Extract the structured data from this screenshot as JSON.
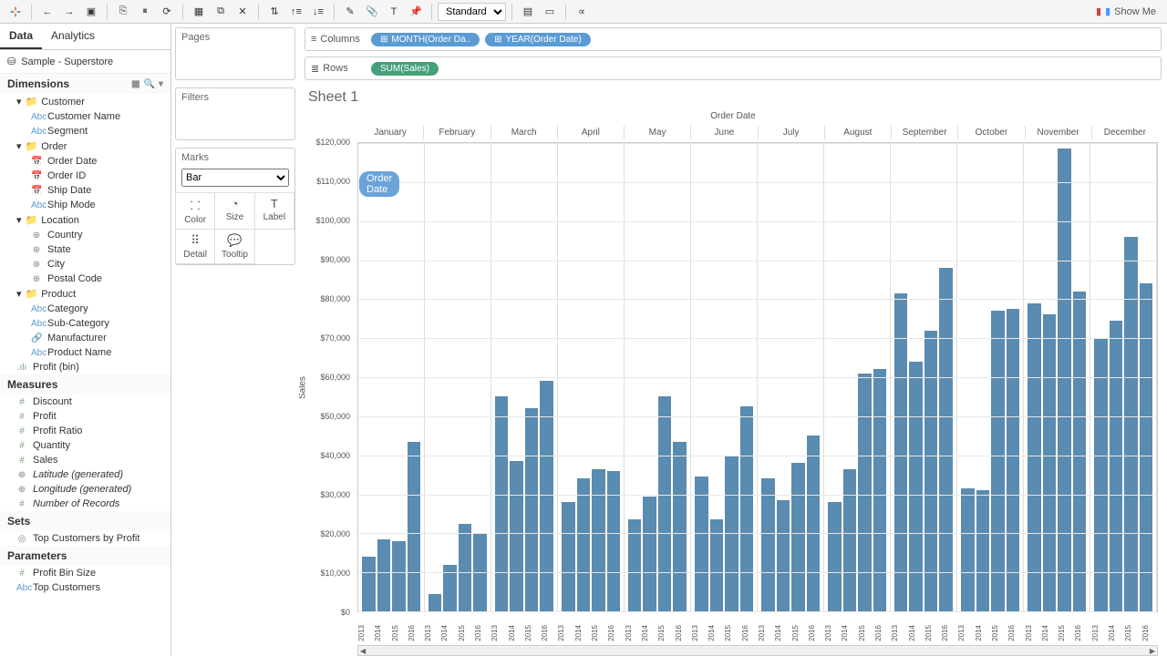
{
  "toolbar": {
    "fit_mode": "Standard",
    "showme_label": "Show Me"
  },
  "data_panel": {
    "tabs": [
      "Data",
      "Analytics"
    ],
    "active_tab": 0,
    "source": "Sample - Superstore",
    "dimensions_label": "Dimensions",
    "measures_label": "Measures",
    "sets_label": "Sets",
    "parameters_label": "Parameters",
    "folders": [
      {
        "name": "Customer",
        "items": [
          {
            "icon": "abc",
            "label": "Customer Name"
          },
          {
            "icon": "abc",
            "label": "Segment"
          }
        ]
      },
      {
        "name": "Order",
        "items": [
          {
            "icon": "date",
            "label": "Order Date"
          },
          {
            "icon": "date",
            "label": "Order ID"
          },
          {
            "icon": "date",
            "label": "Ship Date"
          },
          {
            "icon": "abc",
            "label": "Ship Mode"
          }
        ]
      },
      {
        "name": "Location",
        "items": [
          {
            "icon": "geo",
            "label": "Country"
          },
          {
            "icon": "geo",
            "label": "State"
          },
          {
            "icon": "geo",
            "label": "City"
          },
          {
            "icon": "geo",
            "label": "Postal Code"
          }
        ]
      },
      {
        "name": "Product",
        "items": [
          {
            "icon": "abc",
            "label": "Category"
          },
          {
            "icon": "abc",
            "label": "Sub-Category"
          },
          {
            "icon": "link",
            "label": "Manufacturer"
          },
          {
            "icon": "abc",
            "label": "Product Name"
          }
        ]
      }
    ],
    "dim_tail": {
      "icon": "num",
      "label": "Profit (bin)"
    },
    "measures": [
      {
        "icon": "num",
        "label": "Discount"
      },
      {
        "icon": "num",
        "label": "Profit"
      },
      {
        "icon": "num",
        "label": "Profit Ratio"
      },
      {
        "icon": "num",
        "label": "Quantity"
      },
      {
        "icon": "num",
        "label": "Sales"
      },
      {
        "icon": "geo",
        "label": "Latitude (generated)",
        "italic": true
      },
      {
        "icon": "geo",
        "label": "Longitude (generated)",
        "italic": true
      },
      {
        "icon": "num",
        "label": "Number of Records",
        "italic": true
      }
    ],
    "sets": [
      {
        "icon": "set",
        "label": "Top Customers by Profit"
      }
    ],
    "parameters": [
      {
        "icon": "num",
        "label": "Profit Bin Size"
      },
      {
        "icon": "abc",
        "label": "Top Customers"
      }
    ]
  },
  "shelves": {
    "pages_label": "Pages",
    "filters_label": "Filters",
    "marks_label": "Marks",
    "mark_type": "Bar",
    "drag_ghost": "Order Date",
    "cells": [
      "Color",
      "Size",
      "Label",
      "Detail",
      "Tooltip"
    ]
  },
  "colrow": {
    "columns_label": "Columns",
    "rows_label": "Rows",
    "column_pills": [
      "MONTH(Order Da..",
      "YEAR(Order Date)"
    ],
    "row_pills": [
      "SUM(Sales)"
    ]
  },
  "sheet_title": "Sheet 1",
  "chart_data": {
    "type": "bar",
    "title": "Order Date",
    "ylabel": "Sales",
    "ylim": [
      0,
      120000
    ],
    "y_ticks": [
      "$0",
      "$10,000",
      "$20,000",
      "$30,000",
      "$40,000",
      "$50,000",
      "$60,000",
      "$70,000",
      "$80,000",
      "$90,000",
      "$100,000",
      "$110,000",
      "$120,000"
    ],
    "months": [
      "January",
      "February",
      "March",
      "April",
      "May",
      "June",
      "July",
      "August",
      "September",
      "October",
      "November",
      "December"
    ],
    "years": [
      "2013",
      "2014",
      "2015",
      "2016"
    ],
    "series": [
      {
        "month": "January",
        "values": [
          14000,
          18500,
          18000,
          43500
        ]
      },
      {
        "month": "February",
        "values": [
          4500,
          12000,
          22500,
          20000
        ]
      },
      {
        "month": "March",
        "values": [
          55000,
          38500,
          52000,
          59000
        ]
      },
      {
        "month": "April",
        "values": [
          28000,
          34000,
          36500,
          36000
        ]
      },
      {
        "month": "May",
        "values": [
          23500,
          29500,
          55000,
          43500
        ]
      },
      {
        "month": "June",
        "values": [
          34500,
          23500,
          40000,
          52500
        ]
      },
      {
        "month": "July",
        "values": [
          34000,
          28500,
          38000,
          45000
        ]
      },
      {
        "month": "August",
        "values": [
          28000,
          36500,
          61000,
          62000
        ]
      },
      {
        "month": "September",
        "values": [
          81500,
          64000,
          72000,
          88000
        ]
      },
      {
        "month": "October",
        "values": [
          31500,
          31000,
          77000,
          77500
        ]
      },
      {
        "month": "November",
        "values": [
          79000,
          76000,
          118500,
          82000
        ]
      },
      {
        "month": "December",
        "values": [
          70000,
          74500,
          96000,
          84000
        ]
      }
    ]
  }
}
